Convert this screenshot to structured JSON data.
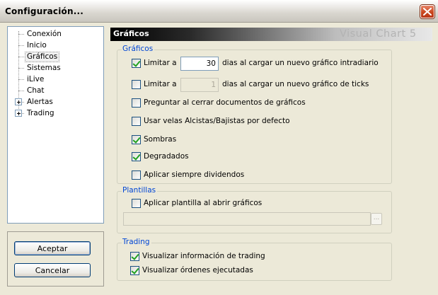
{
  "window": {
    "title": "Configuración..."
  },
  "tree": {
    "items": [
      {
        "label": "Conexión"
      },
      {
        "label": "Inicio"
      },
      {
        "label": "Gráficos"
      },
      {
        "label": "Sistemas"
      },
      {
        "label": "iLive"
      },
      {
        "label": "Chat"
      },
      {
        "label": "Alertas"
      },
      {
        "label": "Trading"
      }
    ]
  },
  "buttons": {
    "accept": "Aceptar",
    "cancel": "Cancelar"
  },
  "header": {
    "title": "Gráficos",
    "brand": "Visual Chart 5"
  },
  "graficos": {
    "legend": "Gráficos",
    "limit_intraday": {
      "label": "Limitar a",
      "value": "30",
      "suffix": "dias al cargar un nuevo gráfico intradiario",
      "checked": true
    },
    "limit_ticks": {
      "label": "Limitar a",
      "value": "1",
      "suffix": "dias al cargar un nuevo gráfico de ticks",
      "checked": false
    },
    "ask_close": {
      "label": "Preguntar al cerrar documentos de gráficos",
      "checked": false
    },
    "bull_bear": {
      "label": "Usar velas Alcistas/Bajistas por defecto",
      "checked": false
    },
    "shadows": {
      "label": "Sombras",
      "checked": true
    },
    "gradients": {
      "label": "Degradados",
      "checked": true
    },
    "dividends": {
      "label": "Aplicar siempre dividendos",
      "checked": false
    }
  },
  "plantillas": {
    "legend": "Plantillas",
    "apply_template": {
      "label": "Aplicar plantilla al abrir gráficos",
      "checked": false
    },
    "template_path": "",
    "browse_label": "..."
  },
  "trading": {
    "legend": "Trading",
    "show_info": {
      "label": "Visualizar información de trading",
      "checked": true
    },
    "show_orders": {
      "label": "Visualizar órdenes ejecutadas",
      "checked": true
    }
  }
}
